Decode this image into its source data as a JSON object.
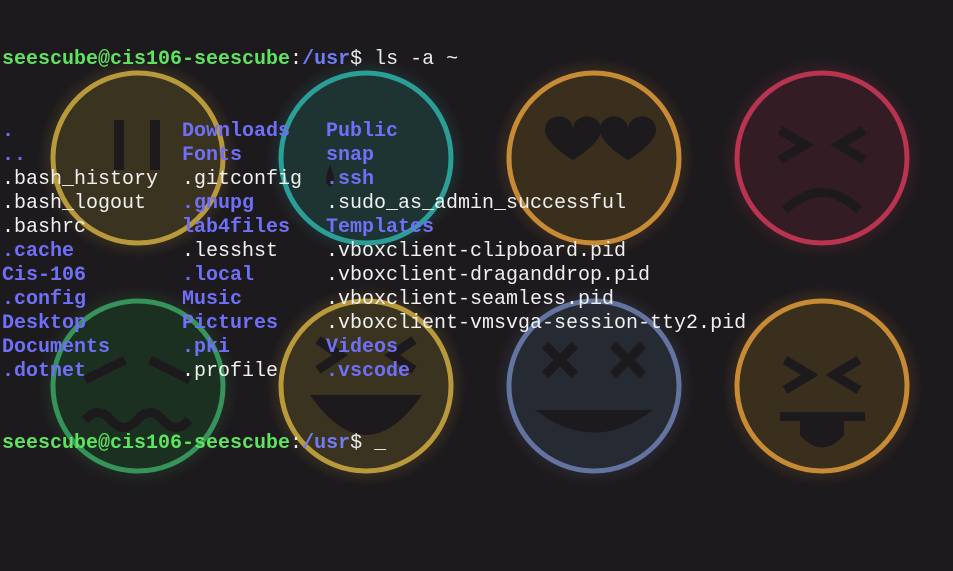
{
  "prompt": {
    "user_host": "seescube@cis106-seescube",
    "sep": ":",
    "path": "/usr",
    "symbol": "$ "
  },
  "command": "ls -a ~",
  "cursor": "_",
  "listing": [
    [
      {
        "name": ".",
        "type": "dir"
      },
      {
        "name": "Downloads",
        "type": "dir"
      },
      {
        "name": "Public",
        "type": "dir"
      }
    ],
    [
      {
        "name": "..",
        "type": "dir"
      },
      {
        "name": "Fonts",
        "type": "dir"
      },
      {
        "name": "snap",
        "type": "dir"
      }
    ],
    [
      {
        "name": ".bash_history",
        "type": "file"
      },
      {
        "name": ".gitconfig",
        "type": "file"
      },
      {
        "name": ".ssh",
        "type": "dir"
      }
    ],
    [
      {
        "name": ".bash_logout",
        "type": "file"
      },
      {
        "name": ".gnupg",
        "type": "dir"
      },
      {
        "name": ".sudo_as_admin_successful",
        "type": "file"
      }
    ],
    [
      {
        "name": ".bashrc",
        "type": "file"
      },
      {
        "name": "lab4files",
        "type": "dir"
      },
      {
        "name": "Templates",
        "type": "dir"
      }
    ],
    [
      {
        "name": ".cache",
        "type": "dir"
      },
      {
        "name": ".lesshst",
        "type": "file"
      },
      {
        "name": ".vboxclient-clipboard.pid",
        "type": "file"
      }
    ],
    [
      {
        "name": "Cis-106",
        "type": "dir"
      },
      {
        "name": ".local",
        "type": "dir"
      },
      {
        "name": ".vboxclient-draganddrop.pid",
        "type": "file"
      }
    ],
    [
      {
        "name": ".config",
        "type": "dir"
      },
      {
        "name": "Music",
        "type": "dir"
      },
      {
        "name": ".vboxclient-seamless.pid",
        "type": "file"
      }
    ],
    [
      {
        "name": "Desktop",
        "type": "dir"
      },
      {
        "name": "Pictures",
        "type": "dir"
      },
      {
        "name": ".vboxclient-vmsvga-session-tty2.pid",
        "type": "file"
      }
    ],
    [
      {
        "name": "Documents",
        "type": "dir"
      },
      {
        "name": ".pki",
        "type": "dir"
      },
      {
        "name": "Videos",
        "type": "dir"
      }
    ],
    [
      {
        "name": ".dotnet",
        "type": "dir"
      },
      {
        "name": ".profile",
        "type": "file"
      },
      {
        "name": ".vscode",
        "type": "dir"
      }
    ]
  ],
  "colors": {
    "background": "#1d1a1d",
    "prompt_user": "#5fe25f",
    "directory": "#6f6ff8",
    "text": "#eaeaea"
  },
  "wallpaper_icons": [
    "neutral-face-icon",
    "teardrop-face-icon",
    "heart-eyes-face-icon",
    "angry-face-icon",
    "wavy-mouth-face-icon",
    "squinting-laugh-face-icon",
    "x-eyes-face-icon",
    "tongue-out-face-icon"
  ]
}
